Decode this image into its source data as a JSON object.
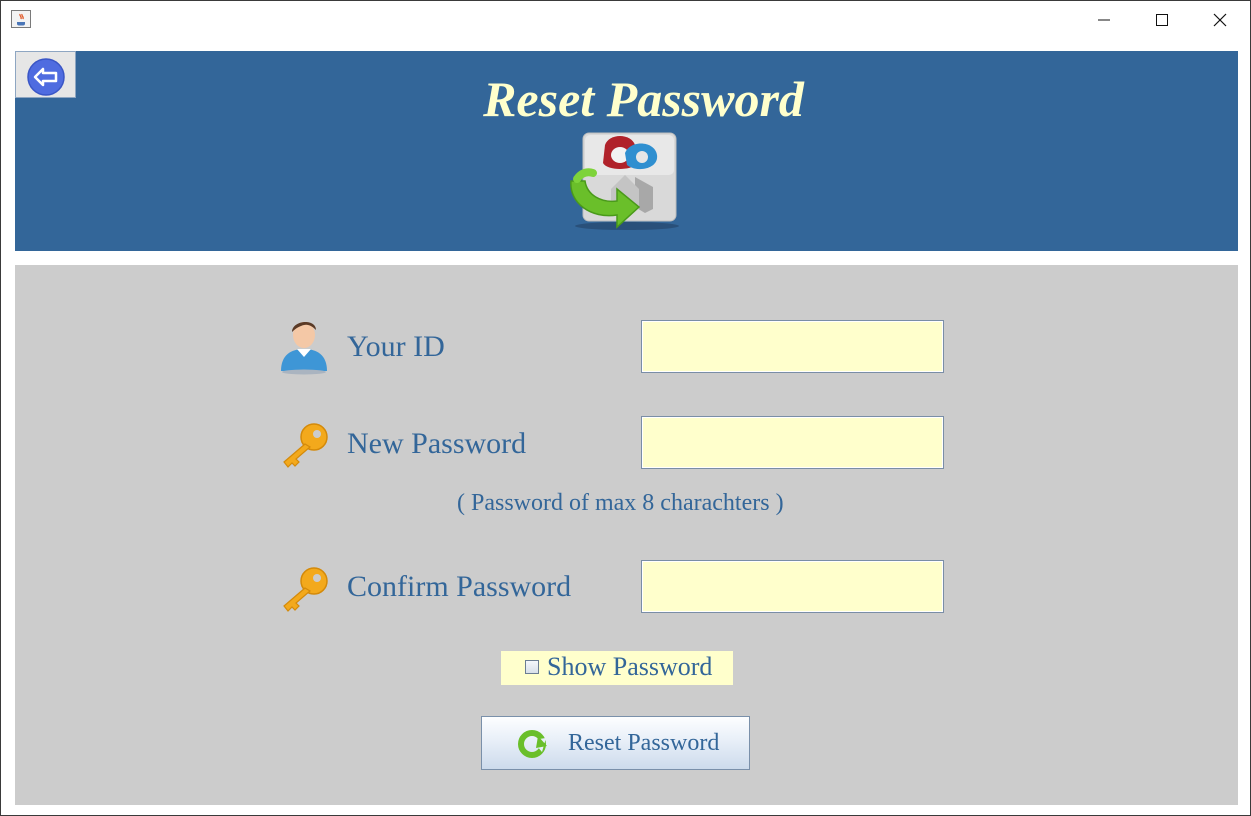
{
  "window": {
    "icon": "java-cup-icon",
    "controls": [
      "minimize-icon",
      "maximize-icon",
      "close-icon"
    ]
  },
  "header": {
    "title": "Reset Password",
    "back_icon": "arrow-left-icon",
    "logo_icon": "key-reset-icon",
    "colors": {
      "background": "#336699",
      "title": "#ffffcc"
    }
  },
  "form": {
    "id_label": "Your ID",
    "id_value": "",
    "new_password_label": "New Password",
    "new_password_value": "",
    "password_hint": "( Password of max 8 charachters )",
    "confirm_password_label": "Confirm Password",
    "confirm_password_value": "",
    "show_password_label": "Show Password",
    "show_password_checked": false,
    "reset_button_label": "Reset Password",
    "colors": {
      "panel": "#cccccc",
      "field": "#ffffcc",
      "text": "#336699"
    }
  }
}
